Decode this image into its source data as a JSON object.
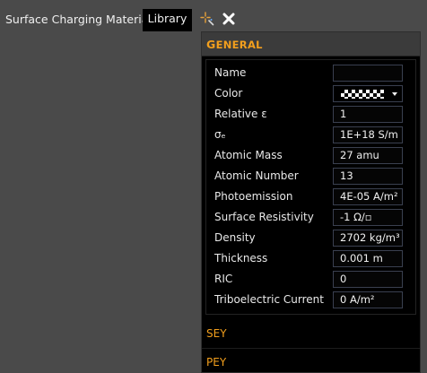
{
  "window": {
    "title": "Surface Charging Material",
    "library_tab": "Library"
  },
  "toolbar": {
    "icons": [
      "sparkle-icon",
      "close-icon"
    ],
    "accent": "#f29f1d"
  },
  "panel": {
    "general_header": "General",
    "general_header_first": "G",
    "general_header_rest": "ENERAL",
    "properties": [
      {
        "label": "Name",
        "value": ""
      },
      {
        "label": "Color",
        "value": ""
      },
      {
        "label": "Relative ε",
        "value": "1"
      },
      {
        "label": "σₑ",
        "value": "1E+18 S/m"
      },
      {
        "label": "Atomic Mass",
        "value": "27 amu"
      },
      {
        "label": "Atomic Number",
        "value": "13"
      },
      {
        "label": "Photoemission",
        "value": "4E-05 A/m²"
      },
      {
        "label": "Surface Resistivity",
        "value": "-1 Ω/▫"
      },
      {
        "label": "Density",
        "value": "2702 kg/m³"
      },
      {
        "label": "Thickness",
        "value": "0.001 m"
      },
      {
        "label": "RIC",
        "value": "0"
      },
      {
        "label": "Triboelectric Current",
        "value": "0 A/m²"
      }
    ],
    "sey_label": "SEY",
    "pey_label": "PEY"
  }
}
